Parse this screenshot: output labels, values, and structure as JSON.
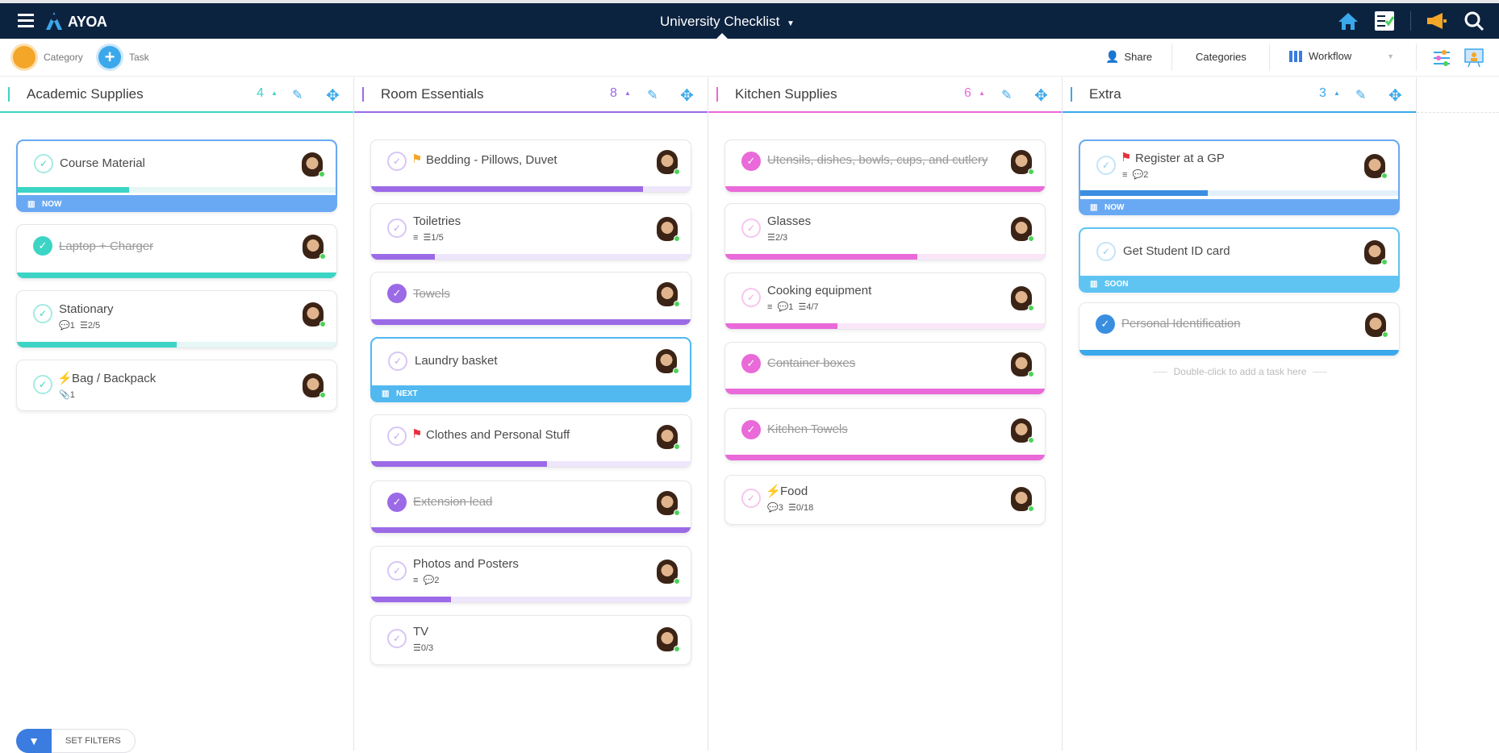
{
  "app": {
    "name": "AYOA",
    "board_title": "University Checklist"
  },
  "toolbar": {
    "category_label": "Category",
    "task_label": "Task",
    "share_label": "Share",
    "categories_label": "Categories",
    "workflow_label": "Workflow",
    "filter_label": "SET FILTERS"
  },
  "colors": {
    "topbar": "#0c2340",
    "academic": "#3cd4c4",
    "room": "#9b6ae6",
    "kitchen": "#e96ad8",
    "extra": "#3aa8ea",
    "now": "#69a9f3",
    "next": "#52b9f0",
    "soon": "#5fc4f2"
  },
  "columns": [
    {
      "title": "Academic Supplies",
      "count": "4",
      "cards": [
        {
          "title": "Course Material",
          "done": false,
          "progress": 0.35,
          "tag": "NOW",
          "meta": ""
        },
        {
          "title": "Laptop + Charger",
          "done": true,
          "progress": 1,
          "meta": ""
        },
        {
          "title": "Stationary",
          "done": false,
          "progress": 0.5,
          "meta_comments": "1",
          "meta_checklist": "2/5"
        },
        {
          "title": "Bag / Backpack",
          "done": false,
          "progress": 0,
          "icon": "bolt-icon",
          "meta_attach": "1"
        }
      ]
    },
    {
      "title": "Room Essentials",
      "count": "8",
      "cards": [
        {
          "title": "Bedding - Pillows, Duvet",
          "done": false,
          "progress": 0.85,
          "icon": "flag-orange-icon"
        },
        {
          "title": "Toiletries",
          "done": false,
          "progress": 0.2,
          "meta_checklist": "1/5"
        },
        {
          "title": "Towels",
          "done": true,
          "progress": 1
        },
        {
          "title": "Laundry basket",
          "done": false,
          "progress": 0,
          "tag": "NEXT"
        },
        {
          "title": "Clothes and Personal Stuff",
          "done": false,
          "progress": 0.55,
          "icon": "flag-red-icon"
        },
        {
          "title": "Extension lead",
          "done": true,
          "progress": 1
        },
        {
          "title": "Photos and Posters",
          "done": false,
          "progress": 0.25,
          "meta_comments": "2"
        },
        {
          "title": "TV",
          "done": false,
          "progress": 0,
          "meta_checklist": "0/3"
        }
      ]
    },
    {
      "title": "Kitchen Supplies",
      "count": "6",
      "cards": [
        {
          "title": "Utensils, dishes, bowls, cups, and cutlery",
          "done": true,
          "progress": 1
        },
        {
          "title": "Glasses",
          "done": false,
          "progress": 0.6,
          "meta_checklist": "2/3"
        },
        {
          "title": "Cooking equipment",
          "done": false,
          "progress": 0.35,
          "meta_comments": "1",
          "meta_checklist": "4/7"
        },
        {
          "title": "Container boxes",
          "done": true,
          "progress": 1
        },
        {
          "title": "Kitchen Towels",
          "done": true,
          "progress": 1
        },
        {
          "title": "Food",
          "done": false,
          "progress": 0,
          "icon": "bolt-icon",
          "meta_comments": "3",
          "meta_checklist": "0/18"
        }
      ]
    },
    {
      "title": "Extra",
      "count": "3",
      "cards": [
        {
          "title": "Register at a GP",
          "done": false,
          "progress": 0.4,
          "icon": "flag-red-icon",
          "meta_comments": "2",
          "tag": "NOW"
        },
        {
          "title": "Get Student ID card",
          "done": false,
          "progress": 0,
          "tag": "SOON"
        },
        {
          "title": "Personal Identification",
          "done": true,
          "progress": 1
        }
      ]
    }
  ],
  "extra_hint": "Double-click to add a task here"
}
